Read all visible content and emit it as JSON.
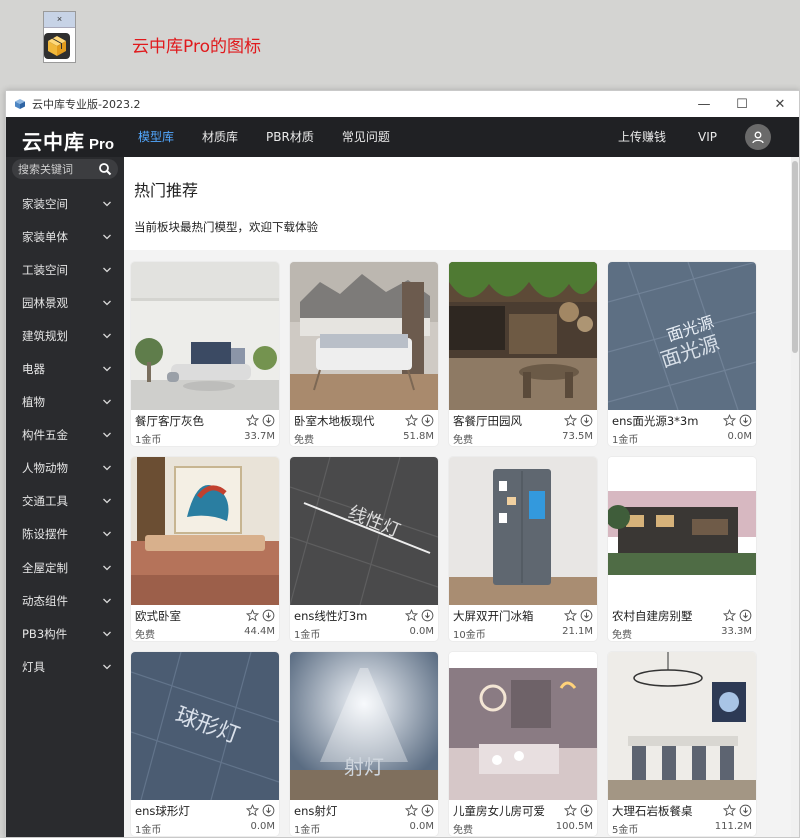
{
  "caption": "云中库Pro的图标",
  "window": {
    "title": "云中库专业版-2023.2",
    "minimize": "—",
    "maximize": "☐",
    "close": "✕"
  },
  "brand": {
    "main": "云中库",
    "sub": "Pro"
  },
  "nav": {
    "items": [
      "模型库",
      "材质库",
      "PBR材质",
      "常见问题"
    ],
    "active": "模型库",
    "upload": "上传赚钱",
    "vip": "VIP"
  },
  "search": {
    "placeholder": "搜索关键词"
  },
  "sidebar": {
    "items": [
      "家装空间",
      "家装单体",
      "工装空间",
      "园林景观",
      "建筑规划",
      "电器",
      "植物",
      "构件五金",
      "人物动物",
      "交通工具",
      "陈设摆件",
      "全屋定制",
      "动态组件",
      "PB3构件",
      "灯具"
    ]
  },
  "hero": {
    "title": "热门推荐",
    "desc": "当前板块最热门模型，欢迎下载体验"
  },
  "cards": [
    {
      "name": "餐厅客厅灰色",
      "price": "1金币",
      "size": "33.7M"
    },
    {
      "name": "卧室木地板现代",
      "price": "免费",
      "size": "51.8M"
    },
    {
      "name": "客餐厅田园风",
      "price": "免费",
      "size": "73.5M"
    },
    {
      "name": "ens面光源3*3m",
      "price": "1金币",
      "size": "0.0M"
    },
    {
      "name": "欧式卧室",
      "price": "免费",
      "size": "44.4M"
    },
    {
      "name": "ens线性灯3m",
      "price": "1金币",
      "size": "0.0M"
    },
    {
      "name": "大屏双开门冰箱",
      "price": "10金币",
      "size": "21.1M"
    },
    {
      "name": "农村自建房别墅",
      "price": "免费",
      "size": "33.3M"
    },
    {
      "name": "ens球形灯",
      "price": "1金币",
      "size": "0.0M"
    },
    {
      "name": "ens射灯",
      "price": "1金币",
      "size": "0.0M"
    },
    {
      "name": "儿童房女儿房可爱",
      "price": "免费",
      "size": "100.5M"
    },
    {
      "name": "大理石岩板餐桌",
      "price": "5金币",
      "size": "111.2M"
    }
  ],
  "thumb_text": {
    "c3": "面光源",
    "c5": "线性灯",
    "c8": "球形灯",
    "c9": "射灯"
  },
  "colors": {
    "nav_active": "#52a8ff",
    "topbar": "#202124",
    "sidebar": "#2a2b2e",
    "caption": "#e0191c"
  }
}
